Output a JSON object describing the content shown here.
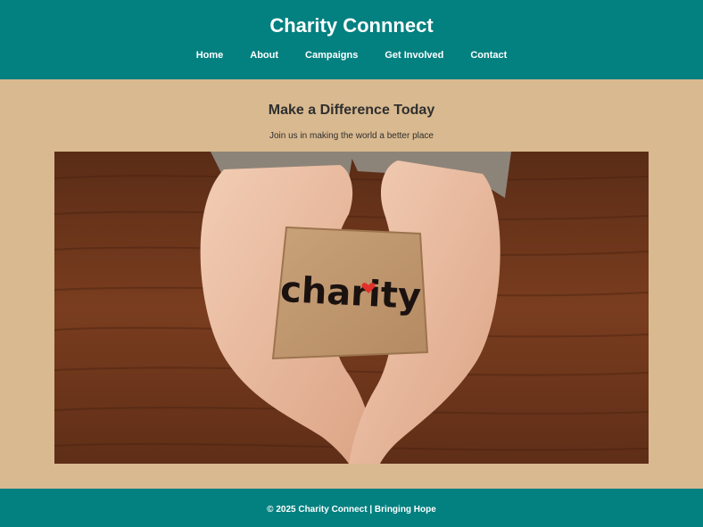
{
  "header": {
    "title": "Charity Connnect",
    "nav": [
      "Home",
      "About",
      "Campaigns",
      "Get Involved",
      "Contact"
    ]
  },
  "hero": {
    "title": "Make a Difference Today",
    "subtitle": "Join us in making the world a better place",
    "image_text": "charity"
  },
  "footer": {
    "text": "© 2025 Charity Connect | Bringing Hope"
  },
  "colors": {
    "header_bg": "#038080",
    "page_bg": "#d9b98f",
    "heart": "#e0322a"
  }
}
